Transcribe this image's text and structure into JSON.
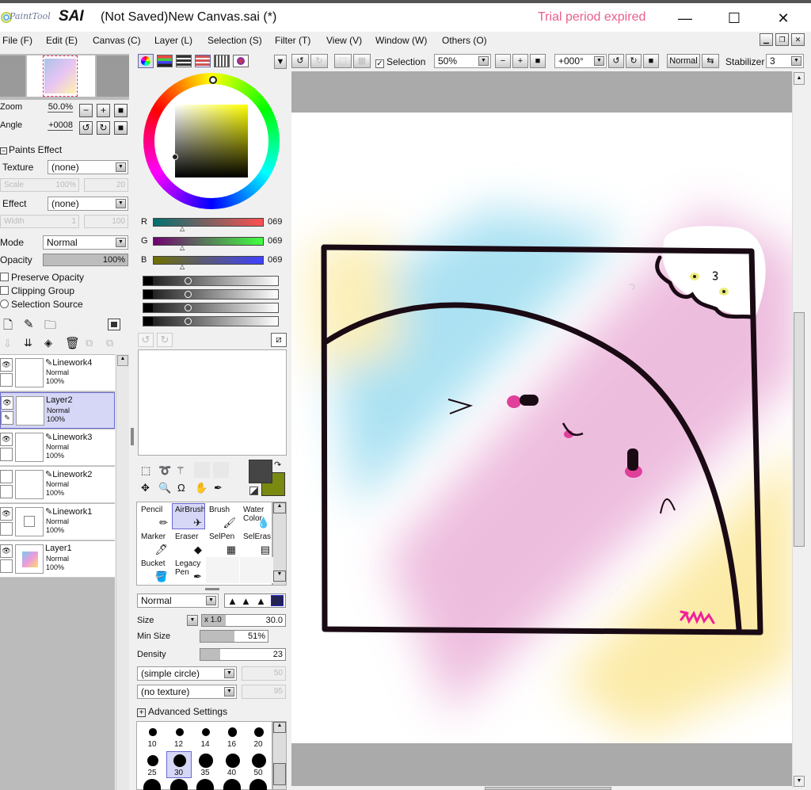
{
  "app": {
    "logo_small": "PaintTool",
    "logo_big": "SAI",
    "title": "(Not Saved)New Canvas.sai (*)",
    "trial": "Trial period expired",
    "win_min": "—",
    "win_max": "☐",
    "win_close": "✕"
  },
  "menu": [
    "File (F)",
    "Edit (E)",
    "Canvas (C)",
    "Layer (L)",
    "Selection (S)",
    "Filter (T)",
    "View (V)",
    "Window (W)",
    "Others (O)"
  ],
  "navigator": {
    "zoom_label": "Zoom",
    "zoom_value": "50.0%",
    "angle_label": "Angle",
    "angle_value": "+0008"
  },
  "paints_effect": {
    "header": "Paints Effect",
    "texture_label": "Texture",
    "texture_value": "(none)",
    "scale_label": "Scale",
    "scale_value": "100%",
    "scale_num": "20",
    "effect_label": "Effect",
    "effect_value": "(none)",
    "width_label": "Width",
    "width_value": "1",
    "width_num": "100"
  },
  "layer_props": {
    "mode_label": "Mode",
    "mode_value": "Normal",
    "opacity_label": "Opacity",
    "opacity_value": "100%",
    "opacity_fraction": 1.0,
    "preserve_opacity": "Preserve Opacity",
    "clipping_group": "Clipping Group",
    "selection_source": "Selection Source"
  },
  "layers": [
    {
      "name": "Linework4",
      "mode": "Normal",
      "opacity": "100%",
      "selected": false,
      "visible": true
    },
    {
      "name": "Layer2",
      "mode": "Normal",
      "opacity": "100%",
      "selected": true,
      "visible": true
    },
    {
      "name": "Linework3",
      "mode": "Normal",
      "opacity": "100%",
      "selected": false,
      "visible": true
    },
    {
      "name": "Linework2",
      "mode": "Normal",
      "opacity": "100%",
      "selected": false,
      "visible": false
    },
    {
      "name": "Linework1",
      "mode": "Normal",
      "opacity": "100%",
      "selected": false,
      "visible": true
    },
    {
      "name": "Layer1",
      "mode": "Normal",
      "opacity": "100%",
      "selected": false,
      "visible": true
    }
  ],
  "color": {
    "r_label": "R",
    "r_value": "069",
    "g_label": "G",
    "g_value": "069",
    "b_label": "B",
    "b_value": "069",
    "primary": "#454545",
    "secondary": "#7a8a10"
  },
  "tools": [
    {
      "name": "Pencil",
      "selected": false
    },
    {
      "name": "AirBrush",
      "selected": true
    },
    {
      "name": "Brush",
      "selected": false
    },
    {
      "name": "Water Color",
      "selected": false
    },
    {
      "name": "Marker",
      "selected": false
    },
    {
      "name": "Eraser",
      "selected": false
    },
    {
      "name": "SelPen",
      "selected": false
    },
    {
      "name": "SelEras",
      "selected": false
    },
    {
      "name": "Bucket",
      "selected": false
    },
    {
      "name": "Legacy Pen",
      "selected": false
    }
  ],
  "brush": {
    "blend_mode": "Normal",
    "size_label": "Size",
    "size_mult": "x 1.0",
    "size_value": "30.0",
    "min_size_label": "Min Size",
    "min_size_value": "51%",
    "min_size_fraction": 0.51,
    "density_label": "Density",
    "density_value": "23",
    "density_fraction": 0.23,
    "shape": "(simple circle)",
    "shape_value": "50",
    "texture": "(no texture)",
    "texture_value": "95",
    "advanced": "Advanced Settings",
    "sizes": [
      "10",
      "12",
      "14",
      "16",
      "20",
      "25",
      "30",
      "35",
      "40",
      "50"
    ],
    "selected_size": "30"
  },
  "toolbar": {
    "selection_label": "Selection",
    "zoom_value": "50%",
    "angle_value": "+000°",
    "blend_value": "Normal",
    "stabilizer_label": "Stabilizer",
    "stabilizer_value": "3"
  },
  "colors": {
    "title_accent": "#e8608a",
    "selected_layer": "#d6d6f6"
  }
}
